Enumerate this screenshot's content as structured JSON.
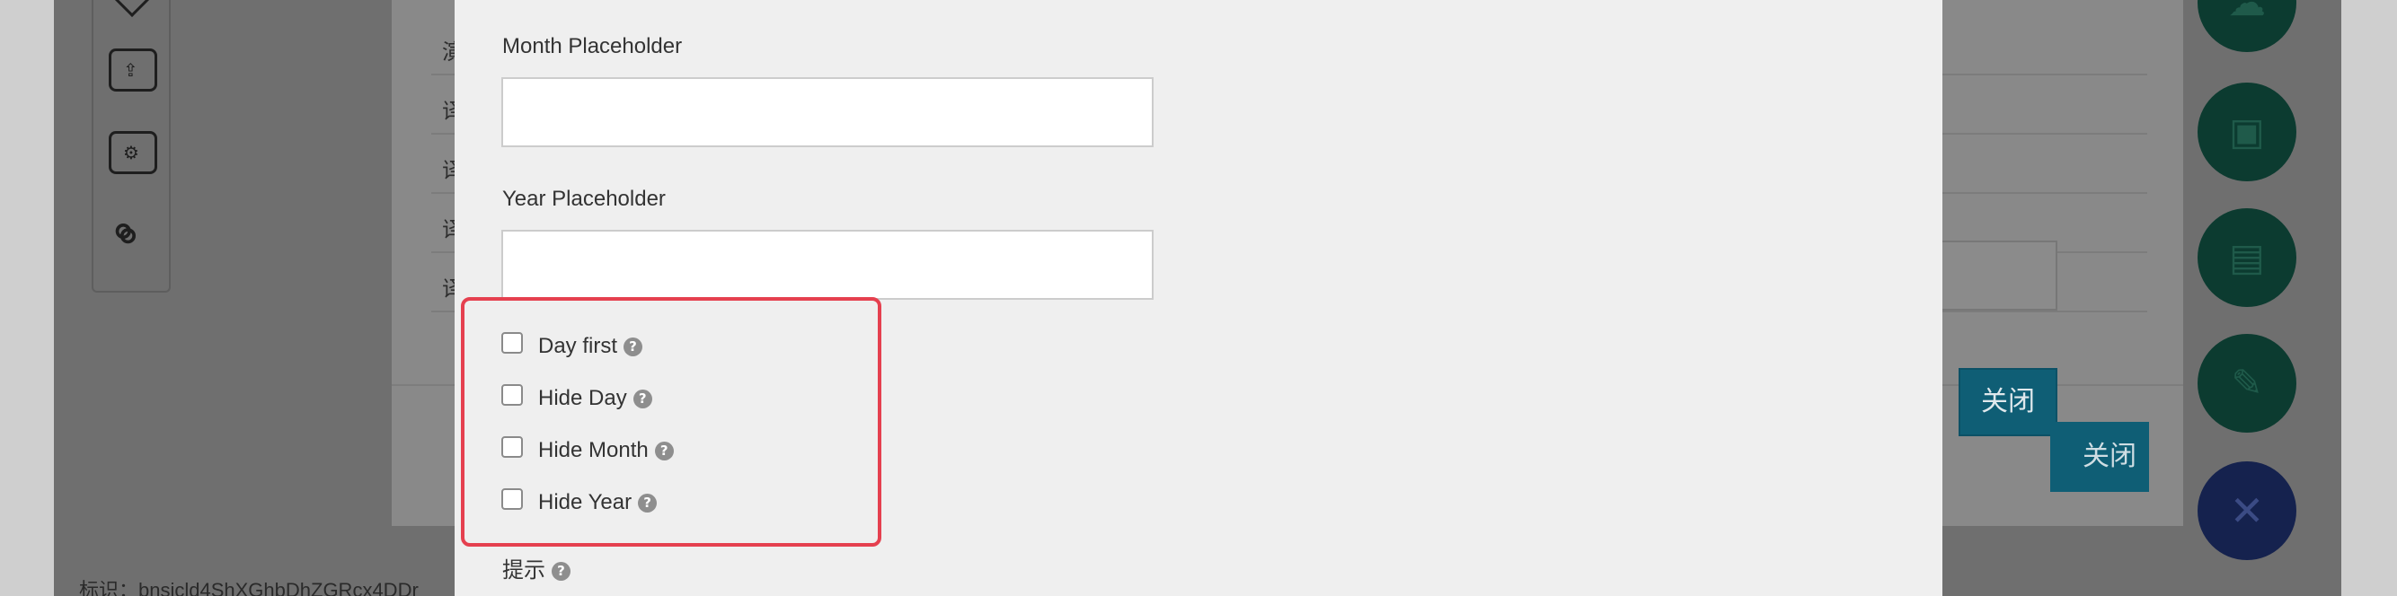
{
  "modal": {
    "month_placeholder_label": "Month Placeholder",
    "month_placeholder_value": "",
    "year_placeholder_label": "Year Placeholder",
    "year_placeholder_value": "",
    "options": [
      {
        "label": "Day first",
        "checked": false
      },
      {
        "label": "Hide Day",
        "checked": false
      },
      {
        "label": "Hide Month",
        "checked": false
      },
      {
        "label": "Hide Year",
        "checked": false
      }
    ],
    "hint_label": "提示",
    "help_glyph": "?"
  },
  "background_dialog": {
    "row_cells": [
      "演",
      "译",
      "译",
      "译",
      "译"
    ],
    "close_label": "关闭",
    "close_label_2": "关闭"
  },
  "background_page": {
    "identifier_text": "标识：bnsicld4ShXGhbDhZGRcx4DDr"
  },
  "icons": {
    "toolbar": [
      "chevron-down-icon",
      "upload-icon",
      "settings-icon",
      "link-icon"
    ],
    "fabs": [
      "cloud-upload-icon",
      "save-icon",
      "clipboard-icon",
      "edit-icon",
      "close-icon"
    ],
    "fab_close_glyph": "✕"
  },
  "colors": {
    "highlight": "#e5404f",
    "primary_button": "#0f5e75",
    "fab": "#0c3b30",
    "fab_close": "#15224e"
  }
}
